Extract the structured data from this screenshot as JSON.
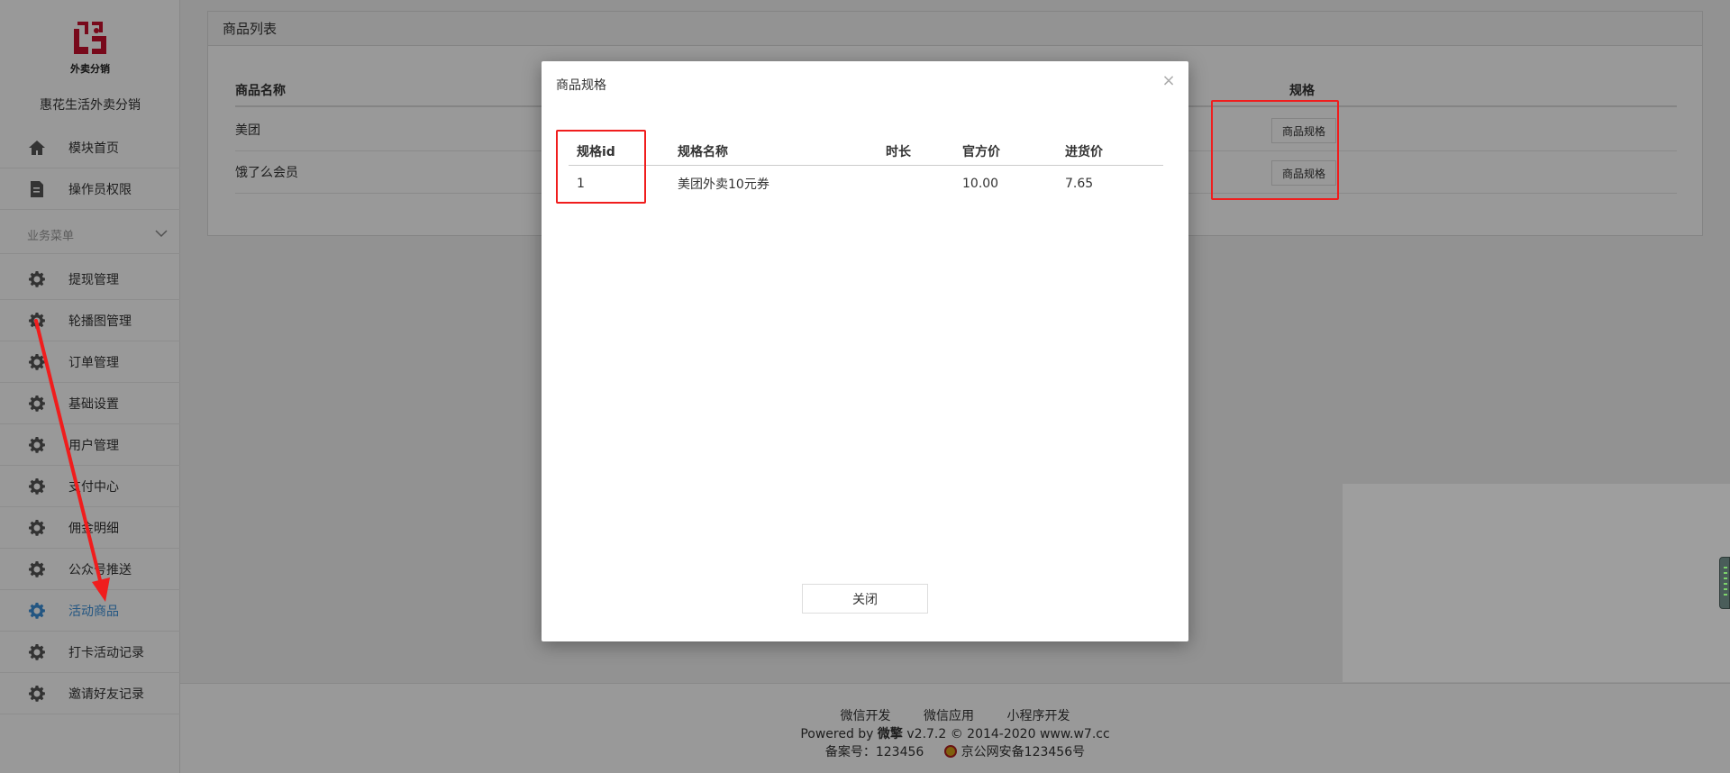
{
  "sidebar": {
    "logo_text": "外卖分销",
    "brand": "惠花生活外卖分销",
    "top_items": [
      {
        "label": "模块首页",
        "icon": "home-icon"
      },
      {
        "label": "操作员权限",
        "icon": "document-edit-icon"
      }
    ],
    "section_title": "业务菜单",
    "items": [
      {
        "label": "提现管理",
        "icon": "gear-icon"
      },
      {
        "label": "轮播图管理",
        "icon": "gear-icon"
      },
      {
        "label": "订单管理",
        "icon": "gear-icon"
      },
      {
        "label": "基础设置",
        "icon": "gear-icon"
      },
      {
        "label": "用户管理",
        "icon": "gear-icon"
      },
      {
        "label": "支付中心",
        "icon": "gear-icon"
      },
      {
        "label": "佣金明细",
        "icon": "gear-icon"
      },
      {
        "label": "公众号推送",
        "icon": "gear-icon"
      },
      {
        "label": "活动商品",
        "icon": "gear-icon",
        "active": true
      },
      {
        "label": "打卡活动记录",
        "icon": "gear-icon"
      },
      {
        "label": "邀请好友记录",
        "icon": "gear-icon"
      }
    ]
  },
  "panel": {
    "title": "商品列表",
    "columns": {
      "name": "商品名称",
      "spec": "规格"
    },
    "rows": [
      {
        "name": "美团",
        "button": "商品规格"
      },
      {
        "name": "饿了么会员",
        "button": "商品规格"
      }
    ]
  },
  "modal": {
    "title": "商品规格",
    "close_icon": "close-icon",
    "columns": [
      "规格id",
      "规格名称",
      "时长",
      "官方价",
      "进货价"
    ],
    "rows": [
      [
        "1",
        "美团外卖10元券",
        "",
        "10.00",
        "7.65"
      ]
    ],
    "close_button": "关闭"
  },
  "footer": {
    "links": [
      "微信开发",
      "微信应用",
      "小程序开发"
    ],
    "powered_prefix": "Powered by ",
    "powered_brand": "微擎",
    "powered_rest": " v2.7.2 © 2014-2020 www.w7.cc",
    "icp": "备案号：123456",
    "police": "京公网安备123456号"
  },
  "colors": {
    "accent": "#3b8fd9",
    "logo_red": "#c8102e",
    "annotation_red": "#f01d1d"
  }
}
